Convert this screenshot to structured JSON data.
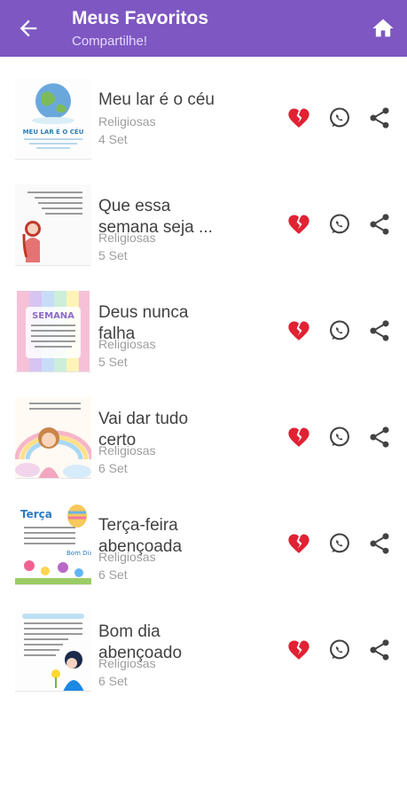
{
  "header": {
    "title": "Meus Favoritos",
    "subtitle": "Compartilhe!",
    "back_icon": "arrow-left-icon",
    "home_icon": "home-icon"
  },
  "colors": {
    "app_bar": "#7e57c2",
    "heart": "#e02233",
    "icon": "#424242"
  },
  "items": [
    {
      "title_lines": [
        "Meu lar é o céu"
      ],
      "category": "Religiosas",
      "count": "4 Set",
      "thumb_text": [
        "MEU LAR É O CÉU"
      ]
    },
    {
      "title_lines": [
        "Que essa",
        "semana seja ..."
      ],
      "category": "Religiosas",
      "count": "5 Set",
      "thumb_text": []
    },
    {
      "title_lines": [
        "Deus nunca",
        "falha"
      ],
      "category": "Religiosas",
      "count": "5 Set",
      "thumb_text": [
        "SEMANA"
      ]
    },
    {
      "title_lines": [
        "Vai dar tudo",
        "certo"
      ],
      "category": "Religiosas",
      "count": "6 Set",
      "thumb_text": []
    },
    {
      "title_lines": [
        "Terça-feira",
        "abençoada"
      ],
      "category": "Religiosas",
      "count": "6 Set",
      "thumb_text": [
        "Terça",
        "Bom Dia"
      ]
    },
    {
      "title_lines": [
        "Bom dia",
        "abençoado"
      ],
      "category": "Religiosas",
      "count": "6 Set",
      "thumb_text": []
    }
  ]
}
